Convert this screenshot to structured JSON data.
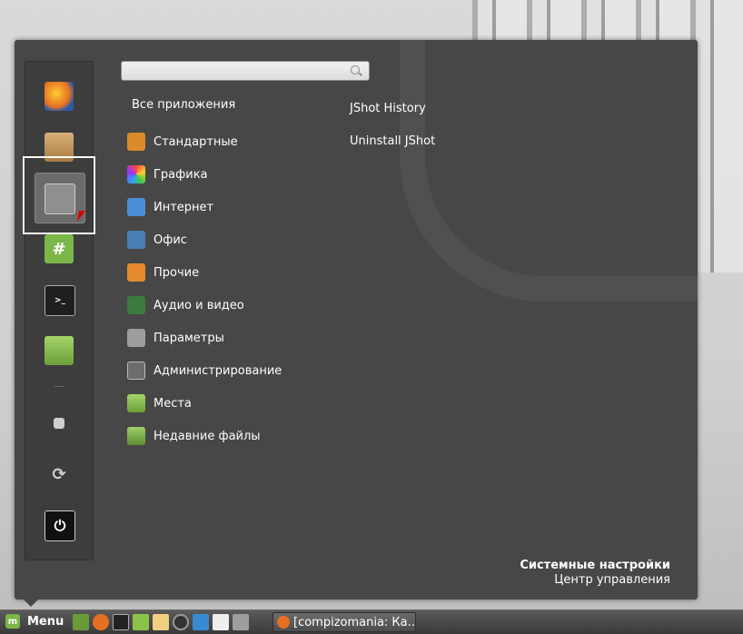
{
  "search": {
    "value": "",
    "placeholder": ""
  },
  "favorites": [
    {
      "name": "firefox-icon",
      "color": "#e67022",
      "glyph": ""
    },
    {
      "name": "package-icon",
      "color": "#c9a06a",
      "glyph": ""
    },
    {
      "name": "system-settings-icon",
      "color": "#8f8f8f",
      "glyph": ""
    },
    {
      "name": "chat-icon",
      "color": "#7ab648",
      "glyph": "#"
    },
    {
      "name": "terminal-icon",
      "color": "#1f1f1f",
      "glyph": ">_"
    },
    {
      "name": "folder-icon",
      "color": "#8bc34a",
      "glyph": ""
    },
    {
      "name": "lock-icon",
      "color": "#cfcfcf",
      "glyph": ""
    },
    {
      "name": "logout-icon",
      "color": "#cfcfcf",
      "glyph": ""
    },
    {
      "name": "power-icon",
      "color": "#111111",
      "glyph": ""
    }
  ],
  "all_apps_label": "Все приложения",
  "categories": [
    {
      "label": "Стандартные",
      "icon": "calculator-icon",
      "color": "#d98a2b"
    },
    {
      "label": "Графика",
      "icon": "graphics-icon",
      "color": "#9c27b0"
    },
    {
      "label": "Интернет",
      "icon": "internet-icon",
      "color": "#4a90d9"
    },
    {
      "label": "Офис",
      "icon": "office-icon",
      "color": "#4a7fb5"
    },
    {
      "label": "Прочие",
      "icon": "other-icon",
      "color": "#e68a2e"
    },
    {
      "label": "Аудио и видео",
      "icon": "multimedia-icon",
      "color": "#3d7a3d"
    },
    {
      "label": "Параметры",
      "icon": "preferences-icon",
      "color": "#9e9e9e"
    },
    {
      "label": "Администрирование",
      "icon": "administration-icon",
      "color": "#6d6d6d"
    },
    {
      "label": "Места",
      "icon": "places-folder-icon",
      "color": "#8bc34a"
    },
    {
      "label": "Недавние файлы",
      "icon": "recent-files-icon",
      "color": "#7ab648"
    }
  ],
  "apps": [
    {
      "label": "JShot History"
    },
    {
      "label": "Uninstall JShot"
    }
  ],
  "system": {
    "title": "Системные настройки",
    "subtitle": "Центр управления"
  },
  "panel": {
    "menu_label": "Menu",
    "launchers": [
      {
        "name": "desktop-icon",
        "color": "#6a9a3a"
      },
      {
        "name": "firefox-icon",
        "color": "#e67022"
      },
      {
        "name": "terminal-icon",
        "color": "#222222"
      },
      {
        "name": "files-icon",
        "color": "#8bc34a"
      },
      {
        "name": "text-editor-icon",
        "color": "#f0d080"
      },
      {
        "name": "media-player-icon",
        "color": "#333333"
      },
      {
        "name": "blue-app-icon",
        "color": "#3a8ad0"
      },
      {
        "name": "notes-icon",
        "color": "#eeeeee"
      },
      {
        "name": "settings-icon",
        "color": "#9e9e9e"
      }
    ],
    "task_label": "[compizomania: Ка..."
  }
}
